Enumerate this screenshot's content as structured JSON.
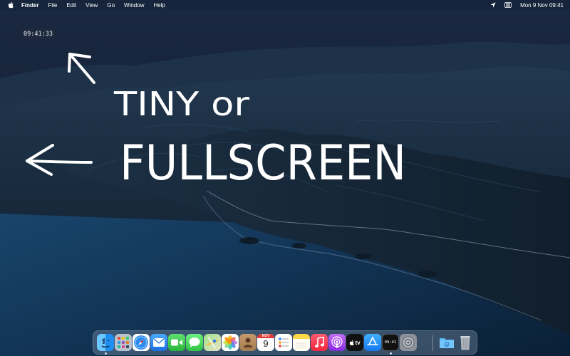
{
  "menubar": {
    "app_name": "Finder",
    "menus": [
      "File",
      "Edit",
      "View",
      "Go",
      "Window",
      "Help"
    ],
    "datetime": "Mon 9 Nov  09:41"
  },
  "tiny_clock": {
    "time": "09:41:33"
  },
  "annotation": {
    "line1": "TINY or",
    "line2": "FULLSCREEN"
  },
  "dock": {
    "calendar": {
      "month": "NOV",
      "day": "9"
    },
    "clock_app": {
      "time": "09:41"
    },
    "tv_label": "tv"
  },
  "colors": {
    "menubar_text": "#ffffff",
    "handwriting": "#ffffff",
    "ocean": "#0f2a4a",
    "sky": "#101c2e"
  }
}
